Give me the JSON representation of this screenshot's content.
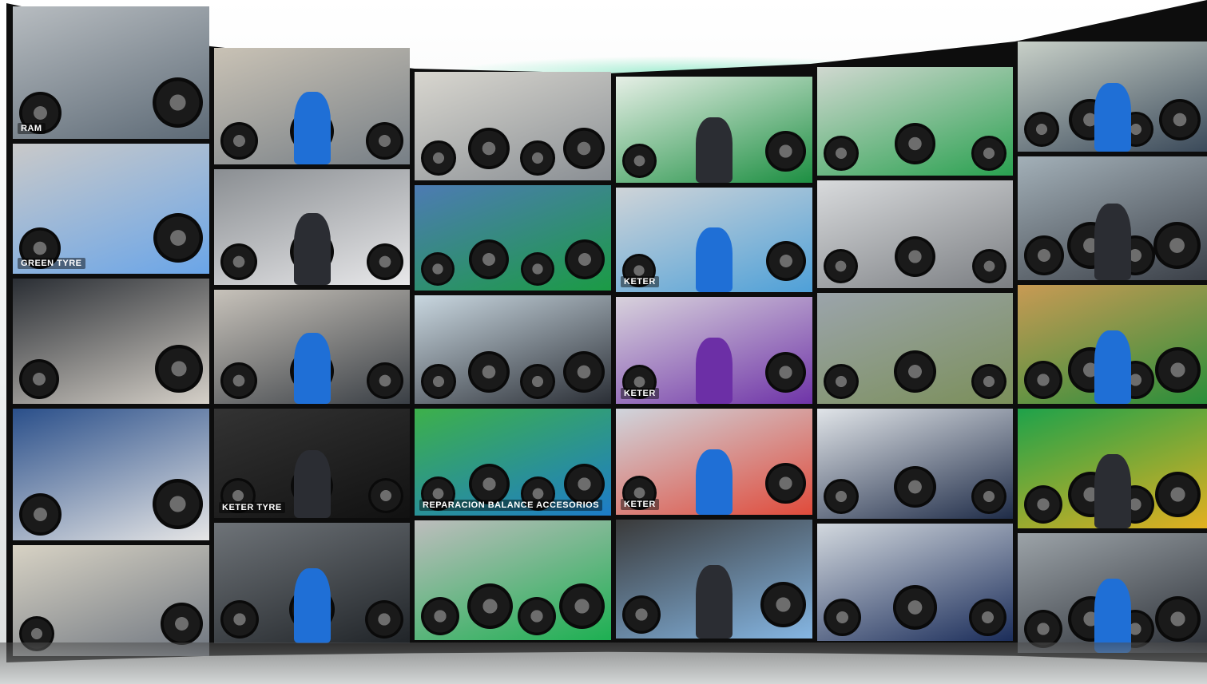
{
  "tiles": [
    {
      "caption": "RAM"
    },
    {
      "caption": ""
    },
    {
      "caption": ""
    },
    {
      "caption": ""
    },
    {
      "caption": ""
    },
    {
      "caption": ""
    },
    {
      "caption": "GREEN TYRE"
    },
    {
      "caption": ""
    },
    {
      "caption": ""
    },
    {
      "caption": "KETER"
    },
    {
      "caption": ""
    },
    {
      "caption": ""
    },
    {
      "caption": ""
    },
    {
      "caption": ""
    },
    {
      "caption": ""
    },
    {
      "caption": "KETER"
    },
    {
      "caption": ""
    },
    {
      "caption": ""
    },
    {
      "caption": ""
    },
    {
      "caption": "KETER TYRE"
    },
    {
      "caption": "REPARACION BALANCE ACCESORIOS"
    },
    {
      "caption": "KETER"
    },
    {
      "caption": ""
    },
    {
      "caption": ""
    },
    {
      "caption": ""
    },
    {
      "caption": ""
    },
    {
      "caption": ""
    },
    {
      "caption": ""
    },
    {
      "caption": ""
    },
    {
      "caption": ""
    }
  ],
  "colors": {
    "frame": "#0d0d0d",
    "keter_green": "#19a64a",
    "keter_purple": "#6c2fa6",
    "shirt_blue": "#1f6fd6"
  }
}
